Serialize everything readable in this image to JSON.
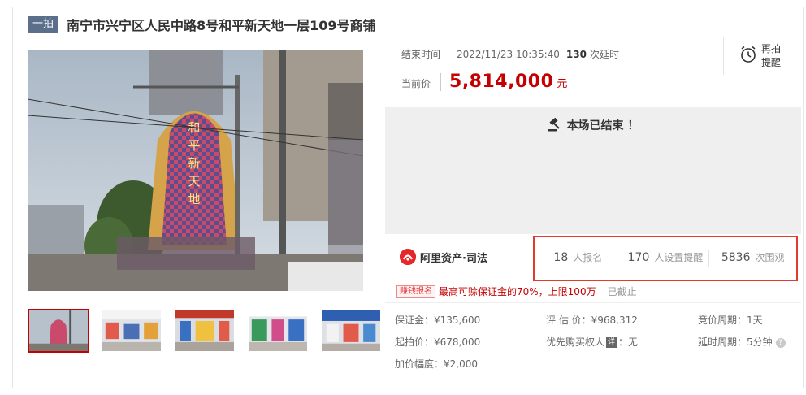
{
  "title": {
    "round_tag": "一拍",
    "text": "南宁市兴宁区人民中路8号和平新天地一层109号商铺"
  },
  "photo": {
    "building_sign": "和平新天地",
    "thumbnail_count": 5
  },
  "auction": {
    "end_time_label": "结束时间",
    "end_time": "2022/11/23 10:35:40",
    "delay_count": "130",
    "delay_suffix": "次延时",
    "price_label": "当前价",
    "price": "5,814,000",
    "price_unit": "元",
    "remind_line1": "再拍",
    "remind_line2": "提醒",
    "ended_message": "本场已结束 ！"
  },
  "brand": {
    "name": "阿里资产·司法"
  },
  "stats": [
    {
      "num": "18",
      "label": "人报名"
    },
    {
      "num": "170",
      "label": "人设置提醒"
    },
    {
      "num": "5836",
      "label": "次围观"
    }
  ],
  "notice": {
    "badge": "赚钱报名",
    "text": "最高可赊保证金的70%，上限100万",
    "status": "已截止"
  },
  "details": {
    "deposit": "保证金：¥135,600",
    "start_price": "起拍价：¥678,000",
    "increment": "加价幅度：¥2,000",
    "appraisal": "评 估 价：¥968,312",
    "priority_label": "优先购买权人",
    "priority_badge": "详",
    "priority_value": "：无",
    "cycle": "竞价周期：1天",
    "delay_cycle": "延时周期：5分钟",
    "help": "?"
  },
  "colors": {
    "accent_red": "#c40000",
    "tag_blue": "#5c6f8a",
    "highlight_box": "#e23a2c"
  },
  "icons": [
    "gavel-icon",
    "alarm-clock-icon",
    "ali-logo-icon",
    "help-icon"
  ]
}
